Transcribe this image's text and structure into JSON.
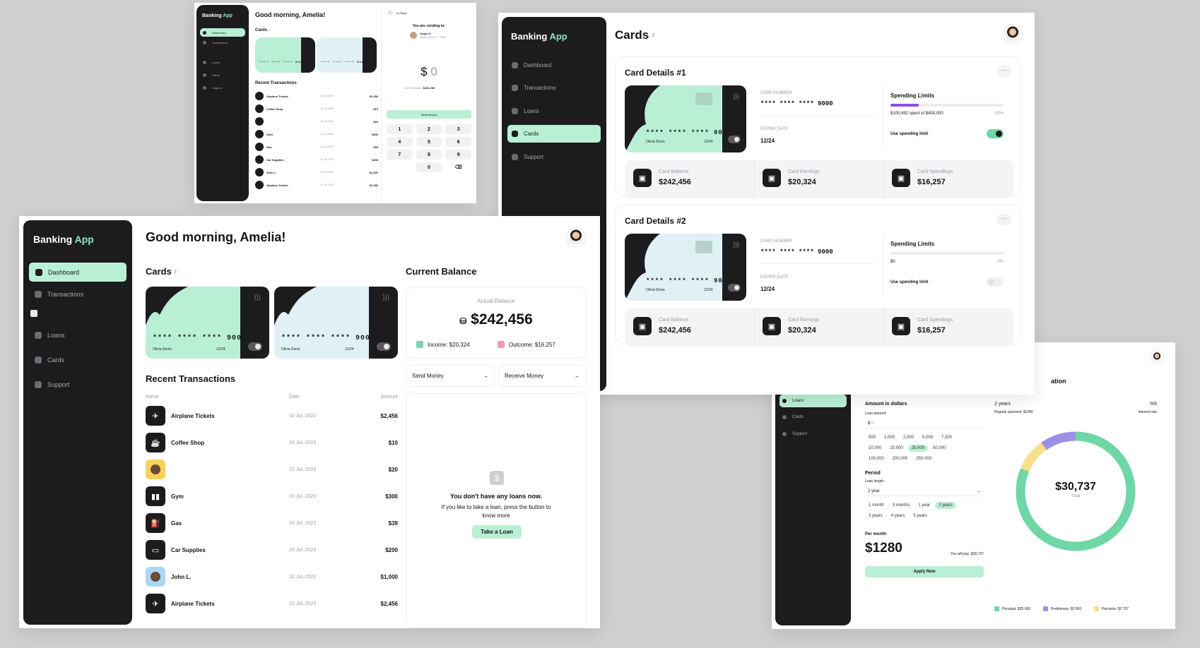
{
  "brand": {
    "name": "Banking",
    "accent": "App"
  },
  "nav": [
    "Dashboard",
    "Transactions",
    "Loans",
    "Cards",
    "Support"
  ],
  "colors": {
    "mint": "#b9efd4",
    "card_blue": "#dff1f5",
    "dark": "#1c1c1f",
    "purple": "#9b8fe6",
    "yellow": "#f6e08a",
    "green": "#6fd6a6"
  },
  "dashboard": {
    "greeting": "Good morning, Amelia!",
    "cards_title": "Cards",
    "cards_count": "2",
    "card_number": "**** **** **** 9000",
    "card_owner": "Olivia Denis",
    "card_exp": "12/24",
    "recent_title": "Recent Transactions",
    "cols": {
      "name": "Name",
      "date": "Date",
      "amount": "Amount"
    },
    "transactions": [
      {
        "name": "Airplane Tickets",
        "date": "10 Jul, 2023",
        "amount": "$2,456",
        "icon": "airplane-icon"
      },
      {
        "name": "Coffee Shop",
        "date": "10 Jul, 2023",
        "amount": "$10",
        "icon": "coffee-icon"
      },
      {
        "name": "",
        "date": "10 Jul, 2023",
        "amount": "$20",
        "icon": "person-avatar"
      },
      {
        "name": "Gym",
        "date": "10 Jul, 2023",
        "amount": "$300",
        "icon": "dumbbell-icon"
      },
      {
        "name": "Gas",
        "date": "10 Jul, 2023",
        "amount": "$39",
        "icon": "gas-pump-icon"
      },
      {
        "name": "Car Supplies",
        "date": "10 Jul, 2023",
        "amount": "$200",
        "icon": "car-icon"
      },
      {
        "name": "John L.",
        "date": "10 Jul, 2023",
        "amount": "$1,000",
        "icon": "person-avatar"
      },
      {
        "name": "Airplane Tickets",
        "date": "10 Jul, 2023",
        "amount": "$2,456",
        "icon": "airplane-icon"
      }
    ],
    "balance_title": "Current Balance",
    "balance_label": "Actual Balance",
    "balance": "$242,456",
    "income": "Income: $20,324",
    "outcome": "Outcome: $16,257",
    "send_money": "Send Money",
    "receive_money": "Receive Money",
    "loan_title": "You don't have any loans now.",
    "loan_text": "If you like to take a loan, press the button to know more",
    "loan_button": "Take a Loan"
  },
  "cards_page": {
    "title": "Cards",
    "count": "2",
    "details": [
      {
        "title": "Card Details #1",
        "card_bg": "#b9efd4",
        "number_label": "CARD NUMBER",
        "number": "**** **** **** 9000",
        "expire_label": "EXPIRE DATE",
        "expire": "12/24",
        "limits_title": "Spending Limits",
        "limits_text": "$100,492 spent of $400,000",
        "limits_pct": "25%",
        "limit_fill": 0.25,
        "use_limit": "Use spending limit",
        "limit_on": true
      },
      {
        "title": "Card Details #2",
        "card_bg": "#dff1f5",
        "number_label": "CARD NUMBER",
        "number": "**** **** **** 9000",
        "expire_label": "EXPIRE DATE",
        "expire": "12/24",
        "limits_title": "Spending Limits",
        "limits_text": "$0",
        "limits_pct": "0%",
        "limit_fill": 0,
        "use_limit": "Use spending limit",
        "limit_on": false
      }
    ],
    "stats": [
      {
        "label": "Card Balance",
        "value": "$242,456"
      },
      {
        "label": "Card Earnings",
        "value": "$20,324"
      },
      {
        "label": "Card Spendings",
        "value": "$16,257"
      }
    ]
  },
  "send": {
    "go_back": "Go Back",
    "sending_to": "You are sending to:",
    "recipient": "Jorge G.",
    "recipient_sub": "Mastercard **** 9000",
    "amount": "$",
    "amount_value": "0",
    "card_balance": "Card Balance:",
    "card_balance_value": "$242,456",
    "send_button": "Send Money",
    "keys": [
      "1",
      "2",
      "3",
      "4",
      "5",
      "6",
      "7",
      "8",
      "9",
      "0"
    ],
    "mini_transactions": [
      {
        "name": "Airplane Tickets",
        "date": "10 Jul, 2023",
        "amount": "$2,456"
      },
      {
        "name": "Coffee Shop",
        "date": "10 Jul, 2023",
        "amount": "$10"
      },
      {
        "name": "",
        "date": "10 Jul, 2023",
        "amount": "$20"
      },
      {
        "name": "Gym",
        "date": "10 Jul, 2023",
        "amount": "$300"
      },
      {
        "name": "Gas",
        "date": "10 Jul, 2023",
        "amount": "$39"
      },
      {
        "name": "Car Supplies",
        "date": "10 Jul, 2023",
        "amount": "$200"
      },
      {
        "name": "John L.",
        "date": "10 Jul, 2023",
        "amount": "$1,000"
      },
      {
        "name": "Airplane Tickets",
        "date": "10 Jul, 2023",
        "amount": "$2,456"
      }
    ]
  },
  "loans": {
    "title_partial": "ation",
    "amount_title": "Amount in dollars",
    "loan_amount_label": "Loan amount:",
    "loan_amount_prefix": "$",
    "amount_chips": [
      [
        "500",
        "1,000",
        "2,000",
        "5,000",
        "7,500"
      ],
      [
        "10,000",
        "20,000",
        "25,000",
        "50,000"
      ],
      [
        "100,000",
        "200,000",
        "250,000"
      ]
    ],
    "selected_amount": "25,000",
    "period_title": "Period",
    "loan_length_label": "Loan length:",
    "loan_length_value": "2 year",
    "period_chips": [
      [
        "1 month",
        "3 months",
        "1 year",
        "2 years"
      ],
      [
        "3 years",
        "4 years",
        "5 years"
      ]
    ],
    "selected_period": "2 years",
    "per_month_label": "Per month:",
    "per_month": "$1280",
    "you_will_pay": "You will pay: $30,737",
    "apply": "Apply Now",
    "term": "2 years",
    "regular_payment": "Regular payment: $1280",
    "rate": "%5",
    "rate_label": "Interest rate",
    "total": "$30,737",
    "total_label": "Total",
    "legend": [
      {
        "label": "Principal: $25 000",
        "color": "#6fd6a6"
      },
      {
        "label": "Preliminary: $3 000",
        "color": "#9b8fe6"
      },
      {
        "label": "Percents: $2 737",
        "color": "#f6e08a"
      }
    ],
    "donut": [
      {
        "value": 25000,
        "color": "#6fd6a6"
      },
      {
        "value": 2737,
        "color": "#f6e08a"
      },
      {
        "value": 3000,
        "color": "#9b8fe6"
      }
    ]
  }
}
